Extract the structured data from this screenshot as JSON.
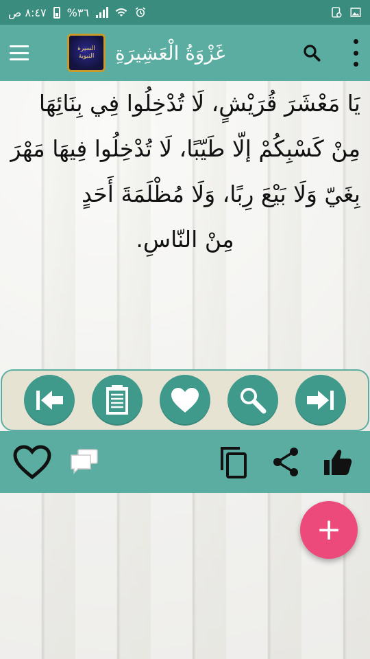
{
  "status_bar": {
    "time": "٨:٤٧ ص",
    "battery": "%٣٦"
  },
  "app_bar": {
    "title": "غَزْوَةُ الْعَشِيرَةِ",
    "logo_line1": "السيرة",
    "logo_line2": "النبوية"
  },
  "content": {
    "paragraph": "يَا مَعْشَرَ قُرَيْشٍ، لَا تُدْخِلُوا فِي بِنَائِهَا مِنْ كَسْبِكُمْ إلّا طَيّبًا، لَا تُدْخِلُوا فِيهَا مَهْرَ بِغَيّ وَلَا بَيْعَ رِبًا، وَلَا مُظْلَمَةَ أَحَدٍ",
    "last_line": "مِنْ النّاسِ."
  },
  "fab": {
    "label": "+"
  },
  "colors": {
    "status_bar": "#3a8d7e",
    "app_bar": "#5aada0",
    "nav_button": "#3f9a8c",
    "nav_panel": "#e6e3d3",
    "fab": "#ec4a7b"
  },
  "icons": {
    "nav": [
      "first-page-icon",
      "clipboard-icon",
      "heart-icon",
      "search-icon",
      "last-page-icon"
    ],
    "actions": [
      "heart-outline-icon",
      "chat-icon",
      "copy-icon",
      "share-icon",
      "thumb-up-icon"
    ]
  }
}
